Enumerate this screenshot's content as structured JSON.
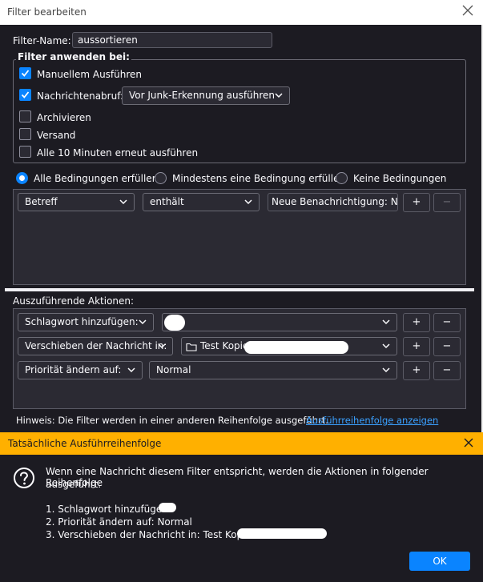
{
  "window": {
    "title": "Filter bearbeiten"
  },
  "filter_name": {
    "label": "Filter-Name:",
    "value": "aussortieren"
  },
  "apply_when": {
    "legend": "Filter anwenden bei:",
    "manual": {
      "label": "Manuellem Ausführen",
      "checked": true
    },
    "fetch": {
      "label": "Nachrichtenabruf:",
      "checked": true,
      "select": "Vor Junk-Erkennung ausführen"
    },
    "archive": {
      "label": "Archivieren",
      "checked": false
    },
    "send": {
      "label": "Versand",
      "checked": false
    },
    "periodic": {
      "label": "Alle 10 Minuten erneut ausführen",
      "checked": false
    }
  },
  "match": {
    "all": "Alle Bedingungen erfüllen",
    "any": "Mindestens eine Bedingung erfüllen",
    "none": "Keine Bedingungen",
    "selected": "all"
  },
  "condition": {
    "field": "Betreff",
    "operator": "enthält",
    "value": "Neue Benachrichtigung: Neue",
    "add": "+",
    "remove": "−"
  },
  "actions": {
    "legend": "Auszuführende Aktionen:",
    "rows": [
      {
        "type": "Schlagwort hinzufügen:",
        "value": ""
      },
      {
        "type": "Verschieben der Nachricht in:",
        "value": "Test Kopie i"
      },
      {
        "type": "Priorität ändern auf:",
        "value": "Normal"
      }
    ],
    "add": "+",
    "remove": "−"
  },
  "hint": {
    "text": "Hinweis: Die Filter werden in einer anderen Reihenfolge ausgeführt.",
    "link": "Ausführreihenfolge anzeigen"
  },
  "dialog": {
    "title": "Tatsächliche Ausführreihenfolge",
    "message_line1": "Wenn eine Nachricht diesem Filter entspricht, werden die Aktionen in folgender Reihenfolge",
    "message_line2": "ausgeführt:",
    "items": [
      "1. Schlagwort hinzufügen:",
      "2. Priorität ändern auf: Normal",
      "3. Verschieben der Nachricht in: Test Kopie in"
    ],
    "ok": "OK"
  },
  "colors": {
    "accent": "#0a84ff",
    "warning": "#ffb000",
    "background": "#1c1b22"
  }
}
